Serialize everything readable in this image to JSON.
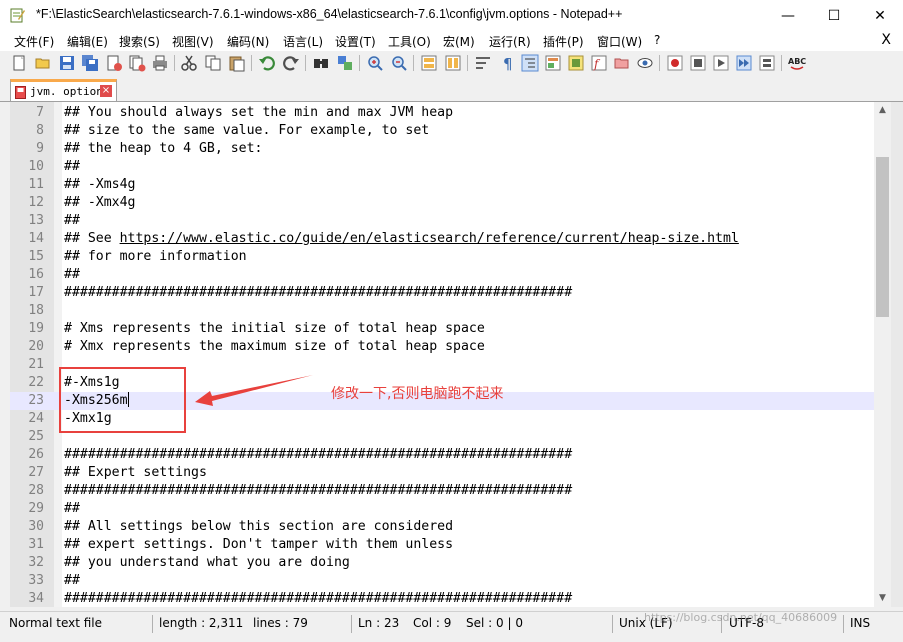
{
  "window": {
    "title": "*F:\\ElasticSearch\\elasticsearch-7.6.1-windows-x86_64\\elasticsearch-7.6.1\\config\\jvm.options - Notepad++",
    "minimize": "—",
    "maximize": "☐",
    "close": "✕"
  },
  "menu": {
    "items": [
      "文件(F)",
      "编辑(E)",
      "搜索(S)",
      "视图(V)",
      "编码(N)",
      "语言(L)",
      "设置(T)",
      "工具(O)",
      "宏(M)",
      "运行(R)",
      "插件(P)",
      "窗口(W)",
      "?"
    ],
    "close_doc": "X"
  },
  "tabs": [
    {
      "label": "jvm. options",
      "close": "×"
    }
  ],
  "editor": {
    "lines": [
      {
        "n": "7",
        "text": "## You should always set the min and max JVM heap"
      },
      {
        "n": "8",
        "text": "## size to the same value. For example, to set"
      },
      {
        "n": "9",
        "text": "## the heap to 4 GB, set:"
      },
      {
        "n": "10",
        "text": "##"
      },
      {
        "n": "11",
        "text": "## -Xms4g"
      },
      {
        "n": "12",
        "text": "## -Xmx4g"
      },
      {
        "n": "13",
        "text": "##"
      },
      {
        "n": "14",
        "pre": "## See ",
        "link": "https://www.elastic.co/guide/en/elasticsearch/reference/current/heap-size.html"
      },
      {
        "n": "15",
        "text": "## for more information"
      },
      {
        "n": "16",
        "text": "##"
      },
      {
        "n": "17",
        "text": "################################################################"
      },
      {
        "n": "18",
        "text": ""
      },
      {
        "n": "19",
        "text": "# Xms represents the initial size of total heap space"
      },
      {
        "n": "20",
        "text": "# Xmx represents the maximum size of total heap space"
      },
      {
        "n": "21",
        "text": ""
      },
      {
        "n": "22",
        "text": "#-Xms1g"
      },
      {
        "n": "23",
        "text": "-Xms256m"
      },
      {
        "n": "24",
        "text": "-Xmx1g"
      },
      {
        "n": "25",
        "text": ""
      },
      {
        "n": "26",
        "text": "################################################################"
      },
      {
        "n": "27",
        "text": "## Expert settings"
      },
      {
        "n": "28",
        "text": "################################################################"
      },
      {
        "n": "29",
        "text": "##"
      },
      {
        "n": "30",
        "text": "## All settings below this section are considered"
      },
      {
        "n": "31",
        "text": "## expert settings. Don't tamper with them unless"
      },
      {
        "n": "32",
        "text": "## you understand what you are doing"
      },
      {
        "n": "33",
        "text": "##"
      },
      {
        "n": "34",
        "text": "################################################################"
      }
    ],
    "current_line": "23"
  },
  "status": {
    "type": "Normal text file",
    "length": "length : 2,311",
    "lines": "lines : 79",
    "ln": "Ln : 23",
    "col": "Col : 9",
    "sel": "Sel : 0 | 0",
    "eol": "Unix (LF)",
    "encoding": "UTF-8",
    "mode": "INS"
  },
  "watermark": "https://blog.csdn.net/qq_40686009",
  "annotation": {
    "text": "修改一下,否则电脑跑不起来",
    "color": "#e8413d"
  },
  "colors": {
    "tab_accent": "#f9a94b",
    "current_line": "#e8e8ff",
    "gutter": "#e4e4e4"
  }
}
